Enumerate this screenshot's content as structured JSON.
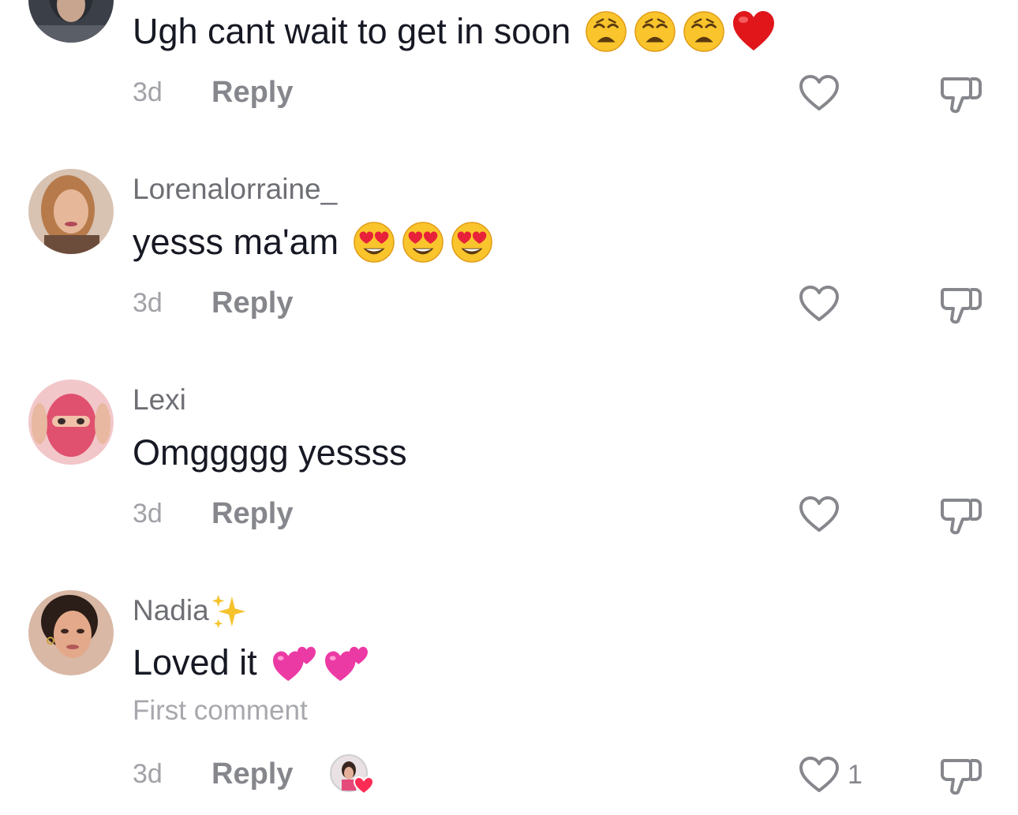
{
  "comments": [
    {
      "username": "",
      "text": "Ugh cant wait to get in soon",
      "emojis": [
        "weary-face",
        "weary-face",
        "weary-face",
        "red-heart"
      ],
      "time": "3d",
      "reply_label": "Reply",
      "like_count": ""
    },
    {
      "username": "Lorenalorraine_",
      "text": "yesss ma'am",
      "emojis": [
        "heart-eyes",
        "heart-eyes",
        "heart-eyes"
      ],
      "time": "3d",
      "reply_label": "Reply",
      "like_count": ""
    },
    {
      "username": "Lexi",
      "text": "Omggggg yessss",
      "emojis": [],
      "time": "3d",
      "reply_label": "Reply",
      "like_count": ""
    },
    {
      "username": "Nadia",
      "username_emoji": "sparkles",
      "text": "Loved it",
      "emojis": [
        "two-hearts",
        "two-hearts"
      ],
      "badge": "First comment",
      "time": "3d",
      "reply_label": "Reply",
      "liked_by_creator": true,
      "like_count": "1"
    }
  ],
  "colors": {
    "text_primary": "#161823",
    "username": "#6e6f75",
    "meta": "#a1a2a7",
    "reply": "#86878c",
    "icon_stroke": "#86878c"
  }
}
